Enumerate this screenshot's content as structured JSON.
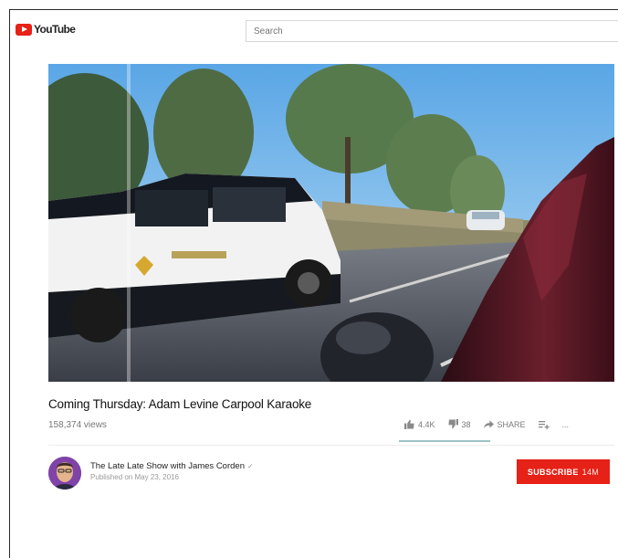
{
  "header": {
    "logo_text": "YouTube",
    "search_placeholder": "Search"
  },
  "video": {
    "title": "Coming Thursday: Adam Levine Carpool Karaoke",
    "views": "158,374 views"
  },
  "actions": {
    "like_count": "4.4K",
    "dislike_count": "38",
    "share_label": "SHARE",
    "more_label": "..."
  },
  "channel": {
    "name": "The Late Late Show with James Corden",
    "verified_mark": "✓",
    "published": "Published on May 23, 2016",
    "subscribe_label": "SUBSCRIBE",
    "subscriber_count": "14M"
  },
  "colors": {
    "brand_red": "#e62117",
    "like_underline": "#9ec3c6"
  }
}
